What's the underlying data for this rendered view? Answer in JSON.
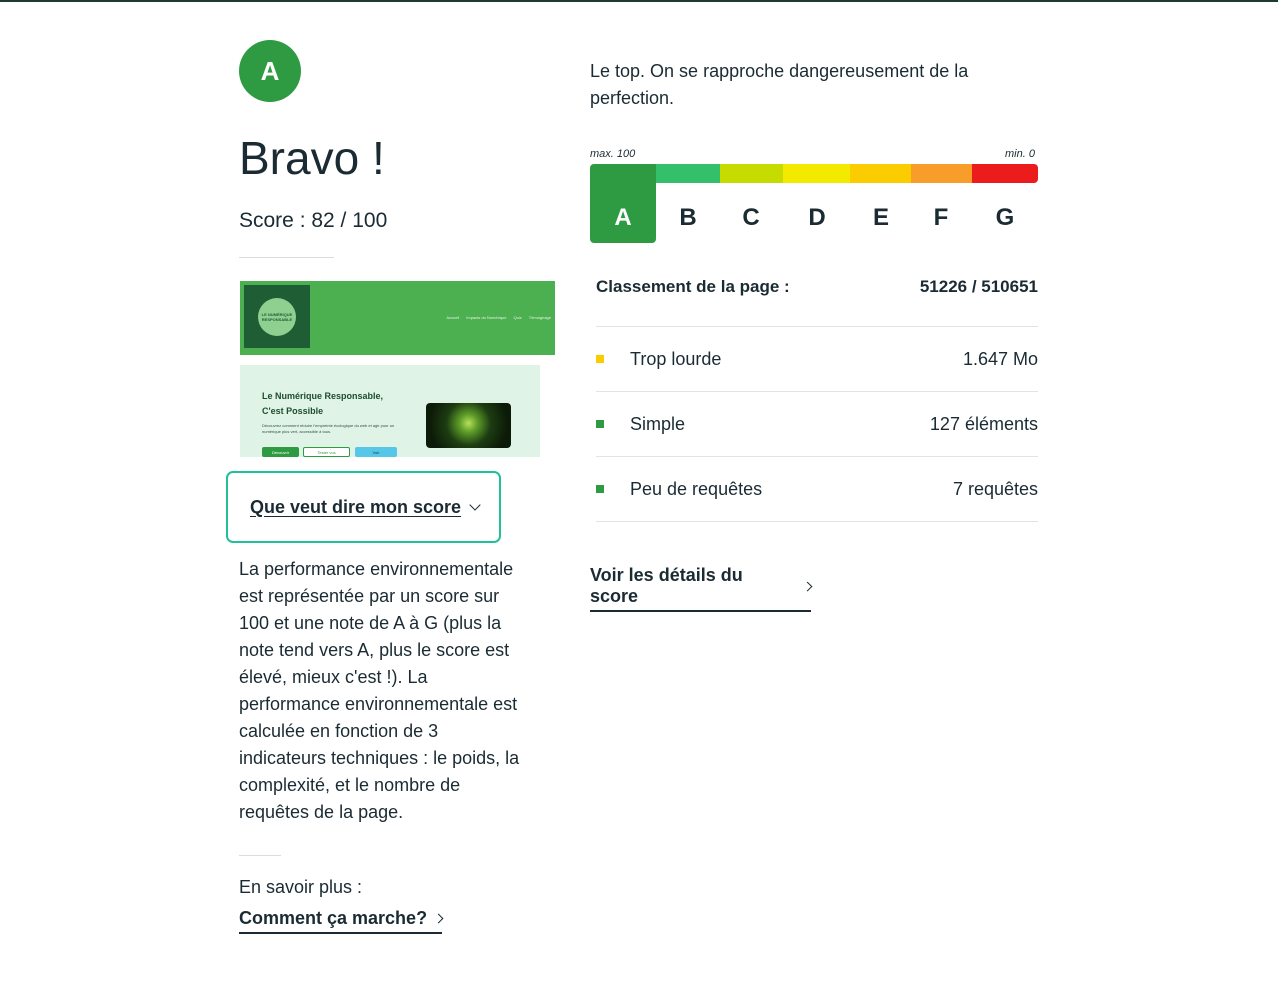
{
  "result": {
    "grade": "A",
    "title": "Bravo !",
    "score_text": "Score : 82 / 100",
    "verdict": "Le top. On se rapproche dangereusement de la perfection."
  },
  "thumbnail": {
    "logo_text": "LE NUMÉRIQUE RESPONSABLE",
    "nav": [
      "Accueil",
      "Impacts du Numérique",
      "Quiz",
      "Témoignage"
    ],
    "hero_title_1": "Le Numérique Responsable,",
    "hero_title_2": "C'est Possible",
    "hero_text": "Découvrez comment réduire l'empreinte écologique du web et agir pour un numérique plus vert, accessible à tous.",
    "buttons": [
      "Découvrir",
      "Tester vos",
      "Voir"
    ]
  },
  "accordion": {
    "label": "Que veut dire mon score"
  },
  "explanation": "La performance environnementale est représentée par un score sur 100 et une note de A à G (plus la note tend vers A, plus le score est élevé, mieux c'est !). La performance environnementale est calculée en fonction de 3 indicateurs techniques : le poids, la complexité, et le nombre de requêtes de la page.",
  "learn_more": {
    "label": "En savoir plus :",
    "link": "Comment ça marche?"
  },
  "scale": {
    "max_label": "max. 100",
    "min_label": "min. 0",
    "active": "A",
    "grades": [
      {
        "letter": "A",
        "color": "#2e9b43"
      },
      {
        "letter": "B",
        "color": "#34c06a"
      },
      {
        "letter": "C",
        "color": "#c6dc00"
      },
      {
        "letter": "D",
        "color": "#f3ea00"
      },
      {
        "letter": "E",
        "color": "#fbcc00"
      },
      {
        "letter": "F",
        "color": "#f89c2a"
      },
      {
        "letter": "G",
        "color": "#ec1c1c"
      }
    ]
  },
  "ranking": {
    "label": "Classement de la page :",
    "value": "51226 / 510651"
  },
  "metrics": [
    {
      "name": "Trop lourde",
      "value": "1.647 Mo",
      "color": "#fbcc00"
    },
    {
      "name": "Simple",
      "value": "127 éléments",
      "color": "#2e9b43"
    },
    {
      "name": "Peu de requêtes",
      "value": "7 requêtes",
      "color": "#2e9b43"
    }
  ],
  "details_link": "Voir les détails du score"
}
